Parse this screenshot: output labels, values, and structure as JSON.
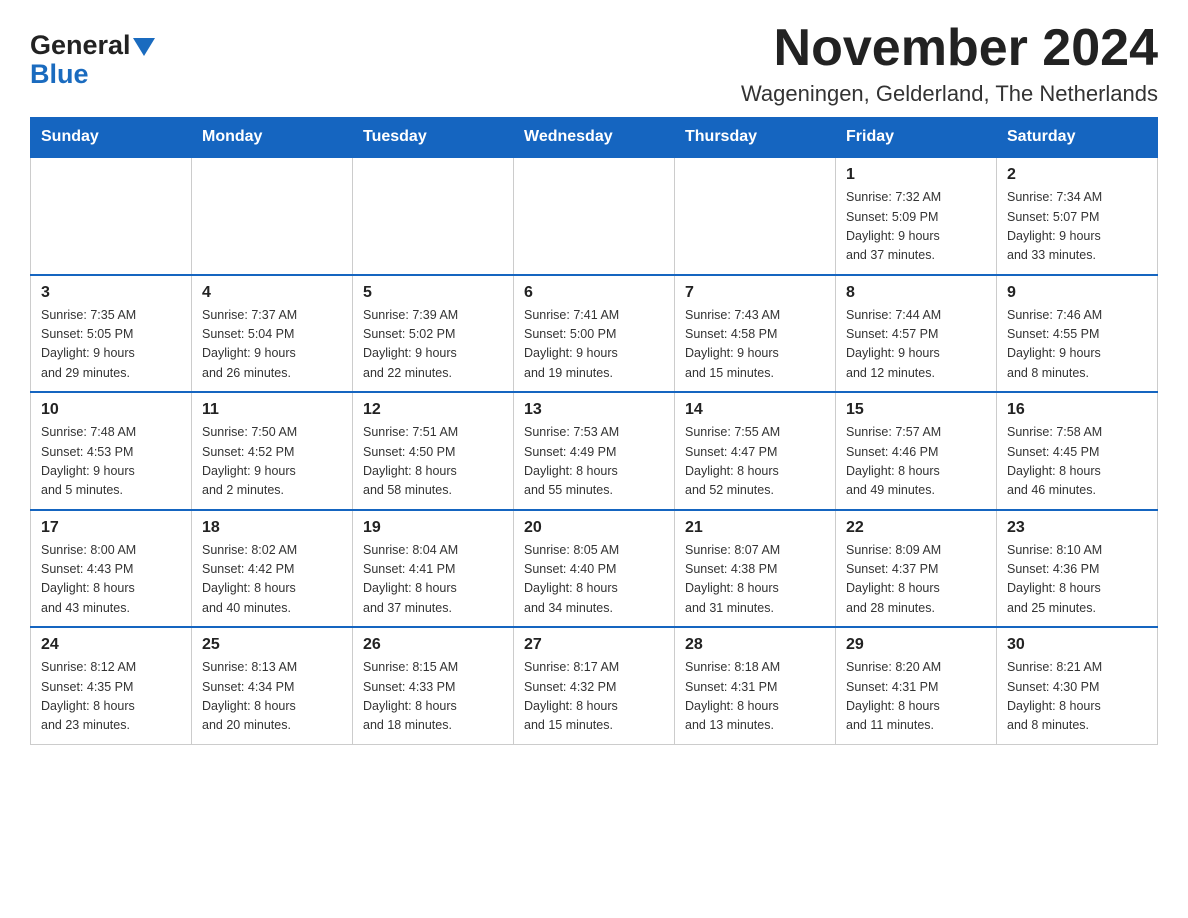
{
  "logo": {
    "general": "General",
    "blue": "Blue"
  },
  "title": "November 2024",
  "subtitle": "Wageningen, Gelderland, The Netherlands",
  "weekdays": [
    "Sunday",
    "Monday",
    "Tuesday",
    "Wednesday",
    "Thursday",
    "Friday",
    "Saturday"
  ],
  "weeks": [
    [
      {
        "day": "",
        "info": ""
      },
      {
        "day": "",
        "info": ""
      },
      {
        "day": "",
        "info": ""
      },
      {
        "day": "",
        "info": ""
      },
      {
        "day": "",
        "info": ""
      },
      {
        "day": "1",
        "info": "Sunrise: 7:32 AM\nSunset: 5:09 PM\nDaylight: 9 hours\nand 37 minutes."
      },
      {
        "day": "2",
        "info": "Sunrise: 7:34 AM\nSunset: 5:07 PM\nDaylight: 9 hours\nand 33 minutes."
      }
    ],
    [
      {
        "day": "3",
        "info": "Sunrise: 7:35 AM\nSunset: 5:05 PM\nDaylight: 9 hours\nand 29 minutes."
      },
      {
        "day": "4",
        "info": "Sunrise: 7:37 AM\nSunset: 5:04 PM\nDaylight: 9 hours\nand 26 minutes."
      },
      {
        "day": "5",
        "info": "Sunrise: 7:39 AM\nSunset: 5:02 PM\nDaylight: 9 hours\nand 22 minutes."
      },
      {
        "day": "6",
        "info": "Sunrise: 7:41 AM\nSunset: 5:00 PM\nDaylight: 9 hours\nand 19 minutes."
      },
      {
        "day": "7",
        "info": "Sunrise: 7:43 AM\nSunset: 4:58 PM\nDaylight: 9 hours\nand 15 minutes."
      },
      {
        "day": "8",
        "info": "Sunrise: 7:44 AM\nSunset: 4:57 PM\nDaylight: 9 hours\nand 12 minutes."
      },
      {
        "day": "9",
        "info": "Sunrise: 7:46 AM\nSunset: 4:55 PM\nDaylight: 9 hours\nand 8 minutes."
      }
    ],
    [
      {
        "day": "10",
        "info": "Sunrise: 7:48 AM\nSunset: 4:53 PM\nDaylight: 9 hours\nand 5 minutes."
      },
      {
        "day": "11",
        "info": "Sunrise: 7:50 AM\nSunset: 4:52 PM\nDaylight: 9 hours\nand 2 minutes."
      },
      {
        "day": "12",
        "info": "Sunrise: 7:51 AM\nSunset: 4:50 PM\nDaylight: 8 hours\nand 58 minutes."
      },
      {
        "day": "13",
        "info": "Sunrise: 7:53 AM\nSunset: 4:49 PM\nDaylight: 8 hours\nand 55 minutes."
      },
      {
        "day": "14",
        "info": "Sunrise: 7:55 AM\nSunset: 4:47 PM\nDaylight: 8 hours\nand 52 minutes."
      },
      {
        "day": "15",
        "info": "Sunrise: 7:57 AM\nSunset: 4:46 PM\nDaylight: 8 hours\nand 49 minutes."
      },
      {
        "day": "16",
        "info": "Sunrise: 7:58 AM\nSunset: 4:45 PM\nDaylight: 8 hours\nand 46 minutes."
      }
    ],
    [
      {
        "day": "17",
        "info": "Sunrise: 8:00 AM\nSunset: 4:43 PM\nDaylight: 8 hours\nand 43 minutes."
      },
      {
        "day": "18",
        "info": "Sunrise: 8:02 AM\nSunset: 4:42 PM\nDaylight: 8 hours\nand 40 minutes."
      },
      {
        "day": "19",
        "info": "Sunrise: 8:04 AM\nSunset: 4:41 PM\nDaylight: 8 hours\nand 37 minutes."
      },
      {
        "day": "20",
        "info": "Sunrise: 8:05 AM\nSunset: 4:40 PM\nDaylight: 8 hours\nand 34 minutes."
      },
      {
        "day": "21",
        "info": "Sunrise: 8:07 AM\nSunset: 4:38 PM\nDaylight: 8 hours\nand 31 minutes."
      },
      {
        "day": "22",
        "info": "Sunrise: 8:09 AM\nSunset: 4:37 PM\nDaylight: 8 hours\nand 28 minutes."
      },
      {
        "day": "23",
        "info": "Sunrise: 8:10 AM\nSunset: 4:36 PM\nDaylight: 8 hours\nand 25 minutes."
      }
    ],
    [
      {
        "day": "24",
        "info": "Sunrise: 8:12 AM\nSunset: 4:35 PM\nDaylight: 8 hours\nand 23 minutes."
      },
      {
        "day": "25",
        "info": "Sunrise: 8:13 AM\nSunset: 4:34 PM\nDaylight: 8 hours\nand 20 minutes."
      },
      {
        "day": "26",
        "info": "Sunrise: 8:15 AM\nSunset: 4:33 PM\nDaylight: 8 hours\nand 18 minutes."
      },
      {
        "day": "27",
        "info": "Sunrise: 8:17 AM\nSunset: 4:32 PM\nDaylight: 8 hours\nand 15 minutes."
      },
      {
        "day": "28",
        "info": "Sunrise: 8:18 AM\nSunset: 4:31 PM\nDaylight: 8 hours\nand 13 minutes."
      },
      {
        "day": "29",
        "info": "Sunrise: 8:20 AM\nSunset: 4:31 PM\nDaylight: 8 hours\nand 11 minutes."
      },
      {
        "day": "30",
        "info": "Sunrise: 8:21 AM\nSunset: 4:30 PM\nDaylight: 8 hours\nand 8 minutes."
      }
    ]
  ]
}
